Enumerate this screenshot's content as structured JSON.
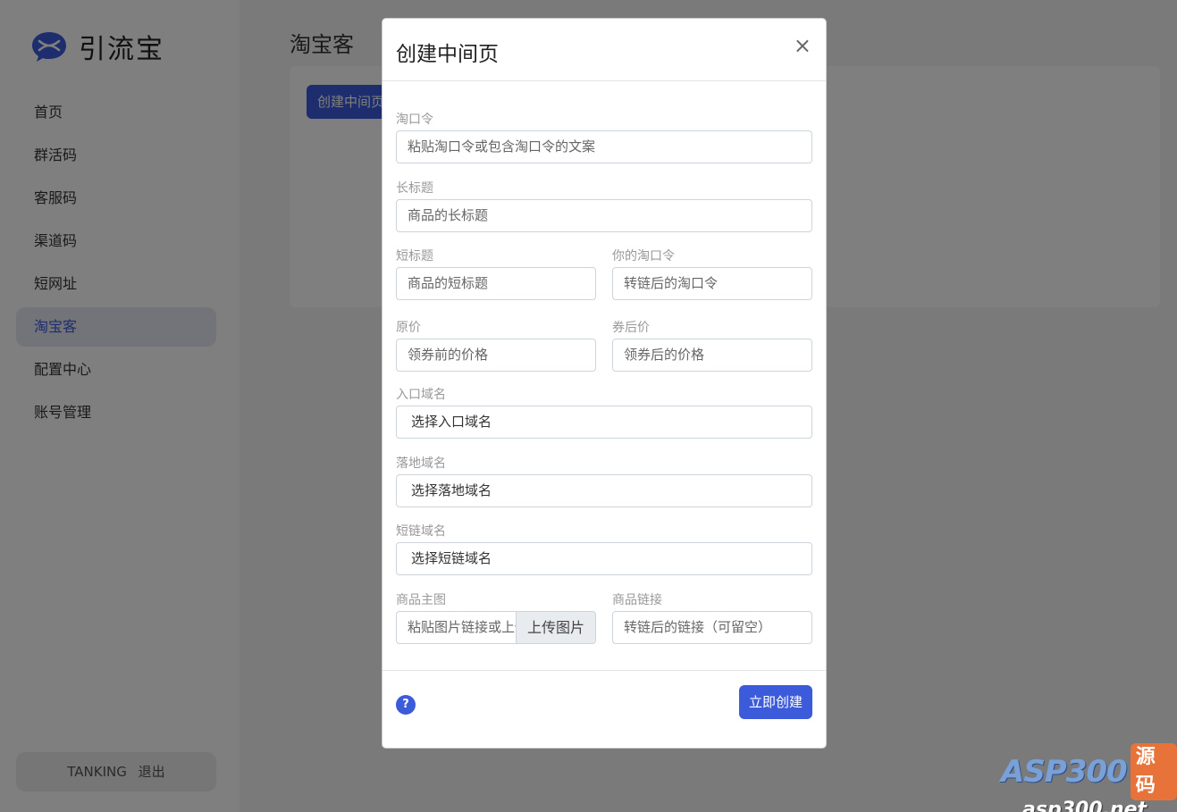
{
  "sidebar": {
    "logo_text": "引流宝",
    "items": [
      {
        "label": "首页"
      },
      {
        "label": "群活码"
      },
      {
        "label": "客服码"
      },
      {
        "label": "渠道码"
      },
      {
        "label": "短网址"
      },
      {
        "label": "淘宝客"
      },
      {
        "label": "配置中心"
      },
      {
        "label": "账号管理"
      }
    ],
    "user": {
      "name": "TANKING",
      "logout": "退出"
    }
  },
  "main": {
    "title": "淘宝客",
    "create_button": "创建中间页"
  },
  "modal": {
    "title": "创建中间页",
    "close": "×",
    "fields": {
      "tkl_label": "淘口令",
      "tkl_placeholder": "粘贴淘口令或包含淘口令的文案",
      "long_title_label": "长标题",
      "long_title_placeholder": "商品的长标题",
      "short_title_label": "短标题",
      "short_title_placeholder": "商品的短标题",
      "your_tkl_label": "你的淘口令",
      "your_tkl_placeholder": "转链后的淘口令",
      "orig_price_label": "原价",
      "orig_price_placeholder": "领券前的价格",
      "coupon_price_label": "券后价",
      "coupon_price_placeholder": "领券后的价格",
      "entry_domain_label": "入口域名",
      "entry_domain_value": "选择入口域名",
      "landing_domain_label": "落地域名",
      "landing_domain_value": "选择落地域名",
      "short_domain_label": "短链域名",
      "short_domain_value": "选择短链域名",
      "main_image_label": "商品主图",
      "main_image_placeholder": "粘贴图片链接或上传图片",
      "upload_button": "上传图片",
      "product_link_label": "商品链接",
      "product_link_placeholder": "转链后的链接（可留空）"
    },
    "help": "?",
    "submit": "立即创建"
  },
  "watermark": {
    "brand": "ASP300",
    "tag": "源码",
    "url": "asp300.net"
  },
  "colors": {
    "accent": "#3b5bdb",
    "overlay": "rgba(0,0,0,0.5)"
  }
}
